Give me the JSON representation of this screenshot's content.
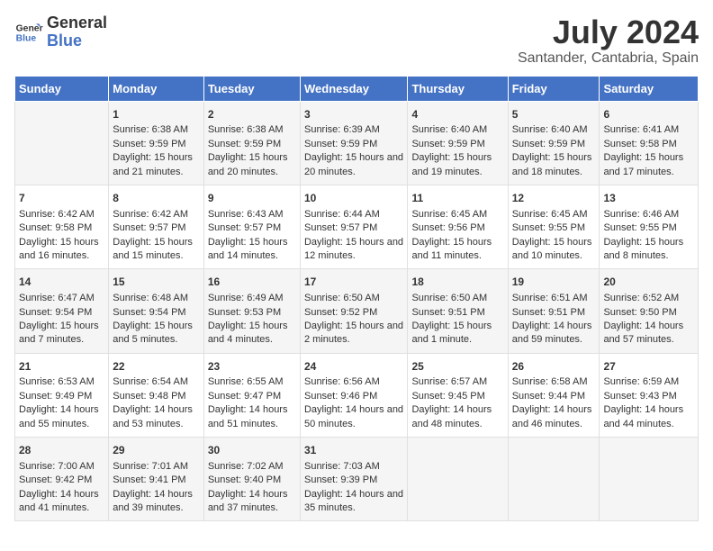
{
  "logo": {
    "line1": "General",
    "line2": "Blue"
  },
  "title": "July 2024",
  "subtitle": "Santander, Cantabria, Spain",
  "days_header": [
    "Sunday",
    "Monday",
    "Tuesday",
    "Wednesday",
    "Thursday",
    "Friday",
    "Saturday"
  ],
  "weeks": [
    [
      {
        "num": "",
        "sunrise": "",
        "sunset": "",
        "daylight": ""
      },
      {
        "num": "1",
        "sunrise": "Sunrise: 6:38 AM",
        "sunset": "Sunset: 9:59 PM",
        "daylight": "Daylight: 15 hours and 21 minutes."
      },
      {
        "num": "2",
        "sunrise": "Sunrise: 6:38 AM",
        "sunset": "Sunset: 9:59 PM",
        "daylight": "Daylight: 15 hours and 20 minutes."
      },
      {
        "num": "3",
        "sunrise": "Sunrise: 6:39 AM",
        "sunset": "Sunset: 9:59 PM",
        "daylight": "Daylight: 15 hours and 20 minutes."
      },
      {
        "num": "4",
        "sunrise": "Sunrise: 6:40 AM",
        "sunset": "Sunset: 9:59 PM",
        "daylight": "Daylight: 15 hours and 19 minutes."
      },
      {
        "num": "5",
        "sunrise": "Sunrise: 6:40 AM",
        "sunset": "Sunset: 9:59 PM",
        "daylight": "Daylight: 15 hours and 18 minutes."
      },
      {
        "num": "6",
        "sunrise": "Sunrise: 6:41 AM",
        "sunset": "Sunset: 9:58 PM",
        "daylight": "Daylight: 15 hours and 17 minutes."
      }
    ],
    [
      {
        "num": "7",
        "sunrise": "Sunrise: 6:42 AM",
        "sunset": "Sunset: 9:58 PM",
        "daylight": "Daylight: 15 hours and 16 minutes."
      },
      {
        "num": "8",
        "sunrise": "Sunrise: 6:42 AM",
        "sunset": "Sunset: 9:57 PM",
        "daylight": "Daylight: 15 hours and 15 minutes."
      },
      {
        "num": "9",
        "sunrise": "Sunrise: 6:43 AM",
        "sunset": "Sunset: 9:57 PM",
        "daylight": "Daylight: 15 hours and 14 minutes."
      },
      {
        "num": "10",
        "sunrise": "Sunrise: 6:44 AM",
        "sunset": "Sunset: 9:57 PM",
        "daylight": "Daylight: 15 hours and 12 minutes."
      },
      {
        "num": "11",
        "sunrise": "Sunrise: 6:45 AM",
        "sunset": "Sunset: 9:56 PM",
        "daylight": "Daylight: 15 hours and 11 minutes."
      },
      {
        "num": "12",
        "sunrise": "Sunrise: 6:45 AM",
        "sunset": "Sunset: 9:55 PM",
        "daylight": "Daylight: 15 hours and 10 minutes."
      },
      {
        "num": "13",
        "sunrise": "Sunrise: 6:46 AM",
        "sunset": "Sunset: 9:55 PM",
        "daylight": "Daylight: 15 hours and 8 minutes."
      }
    ],
    [
      {
        "num": "14",
        "sunrise": "Sunrise: 6:47 AM",
        "sunset": "Sunset: 9:54 PM",
        "daylight": "Daylight: 15 hours and 7 minutes."
      },
      {
        "num": "15",
        "sunrise": "Sunrise: 6:48 AM",
        "sunset": "Sunset: 9:54 PM",
        "daylight": "Daylight: 15 hours and 5 minutes."
      },
      {
        "num": "16",
        "sunrise": "Sunrise: 6:49 AM",
        "sunset": "Sunset: 9:53 PM",
        "daylight": "Daylight: 15 hours and 4 minutes."
      },
      {
        "num": "17",
        "sunrise": "Sunrise: 6:50 AM",
        "sunset": "Sunset: 9:52 PM",
        "daylight": "Daylight: 15 hours and 2 minutes."
      },
      {
        "num": "18",
        "sunrise": "Sunrise: 6:50 AM",
        "sunset": "Sunset: 9:51 PM",
        "daylight": "Daylight: 15 hours and 1 minute."
      },
      {
        "num": "19",
        "sunrise": "Sunrise: 6:51 AM",
        "sunset": "Sunset: 9:51 PM",
        "daylight": "Daylight: 14 hours and 59 minutes."
      },
      {
        "num": "20",
        "sunrise": "Sunrise: 6:52 AM",
        "sunset": "Sunset: 9:50 PM",
        "daylight": "Daylight: 14 hours and 57 minutes."
      }
    ],
    [
      {
        "num": "21",
        "sunrise": "Sunrise: 6:53 AM",
        "sunset": "Sunset: 9:49 PM",
        "daylight": "Daylight: 14 hours and 55 minutes."
      },
      {
        "num": "22",
        "sunrise": "Sunrise: 6:54 AM",
        "sunset": "Sunset: 9:48 PM",
        "daylight": "Daylight: 14 hours and 53 minutes."
      },
      {
        "num": "23",
        "sunrise": "Sunrise: 6:55 AM",
        "sunset": "Sunset: 9:47 PM",
        "daylight": "Daylight: 14 hours and 51 minutes."
      },
      {
        "num": "24",
        "sunrise": "Sunrise: 6:56 AM",
        "sunset": "Sunset: 9:46 PM",
        "daylight": "Daylight: 14 hours and 50 minutes."
      },
      {
        "num": "25",
        "sunrise": "Sunrise: 6:57 AM",
        "sunset": "Sunset: 9:45 PM",
        "daylight": "Daylight: 14 hours and 48 minutes."
      },
      {
        "num": "26",
        "sunrise": "Sunrise: 6:58 AM",
        "sunset": "Sunset: 9:44 PM",
        "daylight": "Daylight: 14 hours and 46 minutes."
      },
      {
        "num": "27",
        "sunrise": "Sunrise: 6:59 AM",
        "sunset": "Sunset: 9:43 PM",
        "daylight": "Daylight: 14 hours and 44 minutes."
      }
    ],
    [
      {
        "num": "28",
        "sunrise": "Sunrise: 7:00 AM",
        "sunset": "Sunset: 9:42 PM",
        "daylight": "Daylight: 14 hours and 41 minutes."
      },
      {
        "num": "29",
        "sunrise": "Sunrise: 7:01 AM",
        "sunset": "Sunset: 9:41 PM",
        "daylight": "Daylight: 14 hours and 39 minutes."
      },
      {
        "num": "30",
        "sunrise": "Sunrise: 7:02 AM",
        "sunset": "Sunset: 9:40 PM",
        "daylight": "Daylight: 14 hours and 37 minutes."
      },
      {
        "num": "31",
        "sunrise": "Sunrise: 7:03 AM",
        "sunset": "Sunset: 9:39 PM",
        "daylight": "Daylight: 14 hours and 35 minutes."
      },
      {
        "num": "",
        "sunrise": "",
        "sunset": "",
        "daylight": ""
      },
      {
        "num": "",
        "sunrise": "",
        "sunset": "",
        "daylight": ""
      },
      {
        "num": "",
        "sunrise": "",
        "sunset": "",
        "daylight": ""
      }
    ]
  ]
}
